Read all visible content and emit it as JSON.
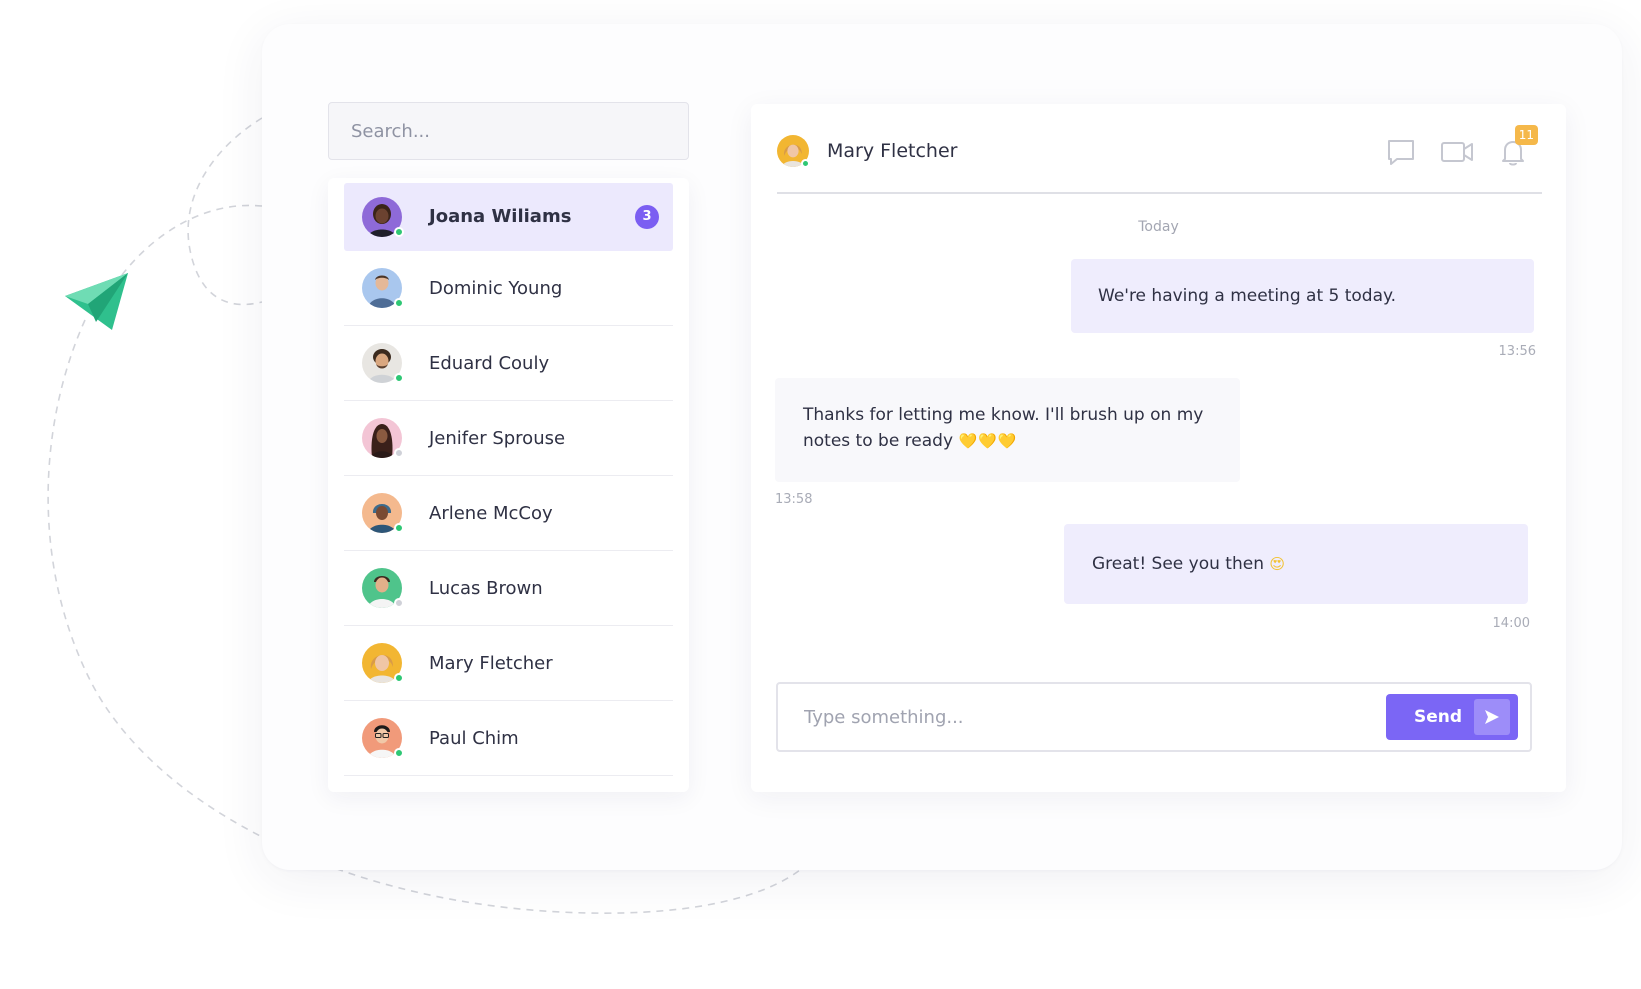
{
  "search": {
    "placeholder": "Search..."
  },
  "contacts": [
    {
      "name": "Joana Wiliams",
      "status": "online",
      "active": true,
      "unread": "3",
      "avatar": "joana-avatar"
    },
    {
      "name": "Dominic Young",
      "status": "online",
      "avatar": "dominic-avatar"
    },
    {
      "name": "Eduard Couly",
      "status": "online",
      "avatar": "eduard-avatar"
    },
    {
      "name": "Jenifer Sprouse",
      "status": "offline",
      "avatar": "jenifer-avatar"
    },
    {
      "name": "Arlene McCoy",
      "status": "online",
      "avatar": "arlene-avatar"
    },
    {
      "name": "Lucas Brown",
      "status": "offline",
      "avatar": "lucas-avatar"
    },
    {
      "name": "Mary Fletcher",
      "status": "online",
      "avatar": "mary-avatar"
    },
    {
      "name": "Paul Chim",
      "status": "online",
      "avatar": "paul-avatar"
    }
  ],
  "chat": {
    "contact_name": "Mary Fletcher",
    "contact_status": "online",
    "notification_count": "11",
    "icons": [
      "chat-icon",
      "video-icon",
      "bell-icon"
    ],
    "day_label": "Today",
    "messages": [
      {
        "direction": "outgoing",
        "text": "We're having a meeting at 5 today.",
        "time": "13:56"
      },
      {
        "direction": "incoming",
        "text_line1": "Thanks for letting me know. I'll brush up on my",
        "text_line2": "notes to be ready",
        "emoji": "💛💛💛",
        "time": "13:58"
      },
      {
        "direction": "outgoing",
        "text": "Great! See you then",
        "emoji": "😍",
        "time": "14:00"
      }
    ],
    "composer": {
      "placeholder": "Type something...",
      "send_label": "Send"
    }
  },
  "colors": {
    "accent": "#7b66f5",
    "badge": "#7b5ef2",
    "online": "#2ec774",
    "notification": "#f5b84a",
    "outgoing_bubble": "#efedfd",
    "paper_plane": "#2fc08d"
  }
}
